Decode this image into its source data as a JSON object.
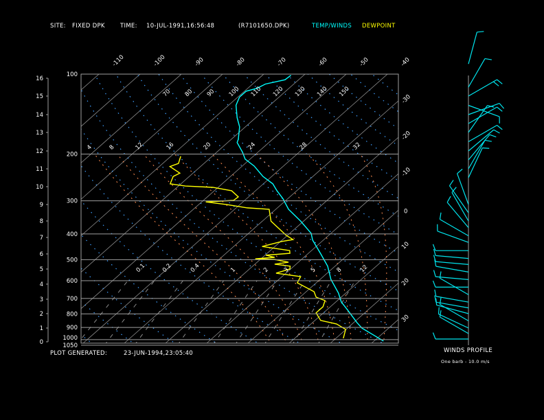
{
  "header": {
    "site_label": "SITE:",
    "site_value": "FIXED DPK",
    "time_label": "TIME:",
    "time_value": "10-JUL-1991,16:56:48",
    "file": "(R7101650.DPK)",
    "legend_temp": "TEMP/WINDS",
    "legend_dew": "DEWPOINT"
  },
  "footer": {
    "generated_label": "PLOT GENERATED:",
    "generated_value": "23-JUN-1994,23:05:40"
  },
  "wind_panel": {
    "title": "WINDS PROFILE",
    "note": "One barb - 10.0 m/s"
  },
  "colors": {
    "background": "#000000",
    "temperature": "#00ffff",
    "dewpoint": "#ffff00",
    "isotherm": "#8c8c8c",
    "dry_adiabat": "#3f9fff",
    "moist_adiabat": "#ff8c50",
    "mixing_ratio": "#8c8c8c",
    "winds": "#00e5ee"
  },
  "chart_data": {
    "type": "line",
    "subtype": "skew-T log-p",
    "series": [
      {
        "name": "TEMP/WINDS",
        "color": "#00ffff",
        "points": [
          [
            101,
            -63.1
          ],
          [
            105,
            -63.3
          ],
          [
            109,
            -66.9
          ],
          [
            113,
            -67.7
          ],
          [
            116,
            -69.6
          ],
          [
            122,
            -69.6
          ],
          [
            131,
            -68.2
          ],
          [
            146,
            -64.5
          ],
          [
            158,
            -61.4
          ],
          [
            176,
            -58.3
          ],
          [
            181,
            -57.7
          ],
          [
            197,
            -53.7
          ],
          [
            209,
            -51.2
          ],
          [
            222,
            -47.1
          ],
          [
            243,
            -42.1
          ],
          [
            259,
            -37.7
          ],
          [
            275,
            -34.8
          ],
          [
            295,
            -31.1
          ],
          [
            323,
            -26.9
          ],
          [
            358,
            -20.7
          ],
          [
            398,
            -14.8
          ],
          [
            422,
            -12.6
          ],
          [
            476,
            -6.8
          ],
          [
            529,
            -1.8
          ],
          [
            593,
            2.6
          ],
          [
            668,
            8.2
          ],
          [
            721,
            11.3
          ],
          [
            780,
            15.5
          ],
          [
            863,
            20.8
          ],
          [
            905,
            23.5
          ],
          [
            972,
            29.1
          ],
          [
            1013,
            32.3
          ]
        ]
      },
      {
        "name": "DEWPOINT",
        "color": "#ffff00",
        "points": [
          [
            204,
            -67.6
          ],
          [
            217,
            -66.2
          ],
          [
            223,
            -67.4
          ],
          [
            236,
            -63.2
          ],
          [
            243,
            -63.9
          ],
          [
            259,
            -62.6
          ],
          [
            264,
            -58.3
          ],
          [
            267,
            -51.3
          ],
          [
            275,
            -45.8
          ],
          [
            290,
            -42.5
          ],
          [
            299,
            -42.7
          ],
          [
            303,
            -49.0
          ],
          [
            310,
            -43.2
          ],
          [
            319,
            -37.3
          ],
          [
            323,
            -31.6
          ],
          [
            358,
            -27.9
          ],
          [
            405,
            -20.3
          ],
          [
            420,
            -17.5
          ],
          [
            427,
            -19.7
          ],
          [
            446,
            -23.1
          ],
          [
            462,
            -15.3
          ],
          [
            473,
            -14.5
          ],
          [
            481,
            -19.8
          ],
          [
            490,
            -17.1
          ],
          [
            496,
            -21.4
          ],
          [
            499,
            -16.5
          ],
          [
            511,
            -12.4
          ],
          [
            520,
            -15.2
          ],
          [
            529,
            -10.9
          ],
          [
            542,
            -10.2
          ],
          [
            562,
            -12.4
          ],
          [
            579,
            -5.5
          ],
          [
            611,
            -4.6
          ],
          [
            660,
            1.9
          ],
          [
            692,
            3.9
          ],
          [
            713,
            7.0
          ],
          [
            752,
            8.2
          ],
          [
            793,
            8.2
          ],
          [
            847,
            11.4
          ],
          [
            873,
            16.2
          ],
          [
            915,
            19.9
          ],
          [
            989,
            21.8
          ]
        ]
      }
    ],
    "pressure_axis": {
      "scale": "log",
      "range": [
        1050,
        100
      ],
      "tick_labels": [
        "100",
        "200",
        "300",
        "400",
        "500",
        "600",
        "700",
        "800",
        "900",
        "1000",
        "1050"
      ],
      "ticks": [
        100,
        200,
        300,
        400,
        500,
        600,
        700,
        800,
        900,
        1000,
        1050
      ]
    },
    "height_axis": {
      "unit": "km",
      "tick_labels": [
        "0",
        "1",
        "2",
        "3",
        "4",
        "5",
        "6",
        "7",
        "8",
        "9",
        "10",
        "11",
        "12",
        "13",
        "14",
        "15",
        "16"
      ]
    },
    "temperature_axis": {
      "unit": "C",
      "skewed": true,
      "top_tick_labels": [
        "-110",
        "-100",
        "-90",
        "-80",
        "-70",
        "-60",
        "-50",
        "-40"
      ],
      "right_tick_labels": [
        "-30",
        "-20",
        "-10",
        "0",
        "10",
        "20",
        "30"
      ]
    },
    "dry_adiabat_labels": [
      "70",
      "80",
      "90",
      "100",
      "110",
      "120",
      "130",
      "140",
      "150"
    ],
    "moist_adiabat_labels": [
      "4",
      "8",
      "12",
      "16",
      "20",
      "24",
      "28",
      "32"
    ],
    "mixing_ratio_labels": [
      "0.1",
      "0.2",
      "0.4",
      "1",
      "2",
      "3",
      "5",
      "8",
      "12"
    ],
    "grid": true,
    "legend": "top"
  },
  "winds": [
    {
      "height_km": 0.2,
      "dir": 270,
      "speed": 10
    },
    {
      "height_km": 0.6,
      "dir": 300,
      "speed": 12
    },
    {
      "height_km": 1.0,
      "dir": 295,
      "speed": 12
    },
    {
      "height_km": 1.5,
      "dir": 300,
      "speed": 10
    },
    {
      "height_km": 2.0,
      "dir": 285,
      "speed": 10
    },
    {
      "height_km": 2.4,
      "dir": 280,
      "speed": 12
    },
    {
      "height_km": 2.8,
      "dir": 280,
      "speed": 10
    },
    {
      "height_km": 3.3,
      "dir": 300,
      "speed": 8
    },
    {
      "height_km": 3.8,
      "dir": 270,
      "speed": 12
    },
    {
      "height_km": 4.3,
      "dir": 275,
      "speed": 12
    },
    {
      "height_km": 4.8,
      "dir": 280,
      "speed": 12
    },
    {
      "height_km": 5.3,
      "dir": 275,
      "speed": 10
    },
    {
      "height_km": 5.7,
      "dir": 275,
      "speed": 12
    },
    {
      "height_km": 6.2,
      "dir": 270,
      "speed": 10
    },
    {
      "height_km": 6.7,
      "dir": 290,
      "speed": 10
    },
    {
      "height_km": 7.1,
      "dir": 300,
      "speed": 8
    },
    {
      "height_km": 7.6,
      "dir": 320,
      "speed": 10
    },
    {
      "height_km": 8.0,
      "dir": 330,
      "speed": 10
    },
    {
      "height_km": 8.5,
      "dir": 325,
      "speed": 8
    },
    {
      "height_km": 9.0,
      "dir": 340,
      "speed": 6
    },
    {
      "height_km": 10.5,
      "dir": 25,
      "speed": 10
    },
    {
      "height_km": 11.0,
      "dir": 30,
      "speed": 10
    },
    {
      "height_km": 11.5,
      "dir": 40,
      "speed": 12
    },
    {
      "height_km": 12.0,
      "dir": 50,
      "speed": 10
    },
    {
      "height_km": 12.5,
      "dir": 60,
      "speed": 10
    },
    {
      "height_km": 13.0,
      "dir": 35,
      "speed": 10
    },
    {
      "height_km": 13.5,
      "dir": 60,
      "speed": 12
    },
    {
      "height_km": 14.0,
      "dir": 70,
      "speed": 12
    },
    {
      "height_km": 14.5,
      "dir": 110,
      "speed": 8
    },
    {
      "height_km": 15.0,
      "dir": 60,
      "speed": 15
    },
    {
      "height_km": 15.5,
      "dir": 30,
      "speed": 10
    },
    {
      "height_km": 16.8,
      "dir": 15,
      "speed": 8
    }
  ]
}
